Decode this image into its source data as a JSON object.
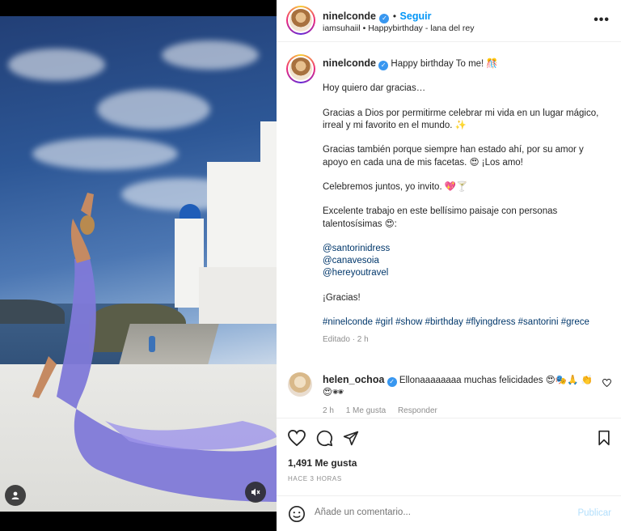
{
  "post": {
    "username": "ninelconde",
    "follow_label": "Seguir",
    "dot": "•",
    "audio_line": "iamsuhaiil • Happybirthday - lana del rey",
    "more_label": "•••"
  },
  "caption": {
    "username": "ninelconde",
    "first_line": "Happy birthday To me! 🎊",
    "paragraphs": [
      "Hoy quiero dar gracias…",
      "Gracias a Dios por permitirme celebrar mi vida en un lugar mágico, irreal y mi favorito en el mundo. ✨",
      "Gracias también porque siempre han estado ahí, por su amor y apoyo en cada una de mis facetas. 😍 ¡Los amo!",
      "Celebremos juntos, yo invito. 💖🍸",
      "Excelente trabajo en este bellísimo paisaje con personas talentosísimas 😍:"
    ],
    "mentions": [
      "@santorinidress",
      "@canavesoia",
      "@hereyoutravel"
    ],
    "thanks": "¡Gracias!",
    "hashtags": "#ninelconde #girl #show #birthday #flyingdress #santorini #grece",
    "edited": "Editado · 2 h"
  },
  "comment": {
    "username": "helen_ochoa",
    "text": "Ellonaaaaaaaa muchas felicidades 😍🎭🙏 👏😍🕶",
    "time": "2 h",
    "likes": "1 Me gusta",
    "reply": "Responder"
  },
  "stats": {
    "likes": "1,491 Me gusta",
    "date": "HACE 3 HORAS"
  },
  "composer": {
    "placeholder": "Añade un comentario...",
    "publish": "Publicar"
  },
  "colors": {
    "link": "#0095f6",
    "hashtag": "#00376b",
    "muted": "#8e8e8e",
    "verified": "#3897f0"
  }
}
